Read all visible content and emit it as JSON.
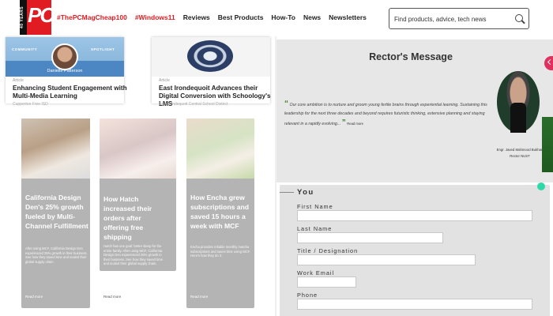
{
  "topbar": {
    "logo_text": "PC",
    "logo_tag": "40 YEARS",
    "nav": {
      "hashtag1": "#ThePCMagCheap100",
      "hashtag2": "#Windows11",
      "links": [
        "Reviews",
        "Best Products",
        "How-To",
        "News",
        "Newsletters"
      ]
    },
    "search": {
      "placeholder": "Find products, advice, tech news"
    }
  },
  "articles": [
    {
      "badge_left": "COMMUNITY",
      "badge_right": "SPOTLIGHT",
      "person": "Danielle Patterson",
      "small": "Article",
      "title": "Enhancing Student Engagement with Multi-Media Learning",
      "sub": "Cupperton Free ISD"
    },
    {
      "small": "Article",
      "title": "East Irondequoit Advances their Digital Conversion with Schoology's LMS",
      "sub": "East Irondequoit Central School District"
    }
  ],
  "case_studies": [
    {
      "title": "California Design Den's 25% growth fueled by Multi-Channel Fulfillment",
      "desc": "After using MCF, California Design Den experienced 25% growth in their business. See how they saved time and scaled their global supply chain.",
      "more": "Read more"
    },
    {
      "title": "How Hatch increased their orders after offering free shipping",
      "desc": "Hatch has one goal: better sleep for the entire family. After using MCF, California Design Den experienced 25% growth in their business. See how they saved time and scaled their global supply chain.",
      "more": "Read more"
    },
    {
      "title": "How Encha grew subscriptions and saved 15 hours a week with MCF",
      "desc": "Encha provides reliable monthly matcha subscriptions and saves time using MCF. Here's how they do it.",
      "more": "Read more"
    }
  ],
  "rector": {
    "heading": "Rector's Message",
    "quote": "Our core ambition is to nurture and groom young fertile brains through experiential learning. Sustaining this leadership for the next three decades and beyond requires futuristic thinking, extensive planning and staying relevant in a rapidly evolving...",
    "read_more": "Read more",
    "name": "Engr. Javed Mahmood Bukhari",
    "role": "Rector NUST"
  },
  "form": {
    "legend": "You",
    "fields": [
      {
        "label": "First Name",
        "value": ""
      },
      {
        "label": "Last Name",
        "value": ""
      },
      {
        "label": "Title / Designation",
        "value": ""
      },
      {
        "label": "Work Email",
        "value": ""
      },
      {
        "label": "Phone",
        "value": ""
      }
    ]
  },
  "colors": {
    "brand_red": "#e11b22",
    "card_gray": "#b4b4b4",
    "quote_green": "#3b7a1e",
    "accent_pink": "#e0305e",
    "accent_teal": "#2fd8a8"
  }
}
